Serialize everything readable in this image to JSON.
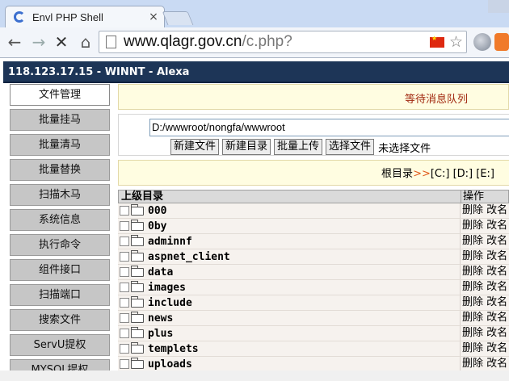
{
  "browser": {
    "tab_title": "Envl PHP Shell",
    "tab_close": "×",
    "url_domain": "www.qlagr.gov.cn",
    "url_path": "/c.php?",
    "nav_back": "←",
    "nav_forward": "→",
    "nav_stop": "✕",
    "nav_home": "⌂",
    "star": "☆"
  },
  "header": {
    "title": "118.123.17.15 - WINNT - Alexa"
  },
  "sidebar": {
    "items": [
      {
        "label": "文件管理",
        "active": true
      },
      {
        "label": "批量挂马"
      },
      {
        "label": "批量清马"
      },
      {
        "label": "批量替换"
      },
      {
        "label": "扫描木马"
      },
      {
        "label": "系统信息"
      },
      {
        "label": "执行命令"
      },
      {
        "label": "组件接口"
      },
      {
        "label": "扫描端口"
      },
      {
        "label": "搜索文件"
      },
      {
        "label": "ServU提权"
      },
      {
        "label": "MYSQL提权"
      }
    ]
  },
  "notice": {
    "message": "等待消息队列"
  },
  "path_bar": {
    "path": "D:/wwwroot/nongfa/wwwroot",
    "new_file": "新建文件",
    "new_dir": "新建目录",
    "batch_upload": "批量上传",
    "choose_file": "选择文件",
    "no_file": "未选择文件"
  },
  "drives": {
    "root_label": "根目录",
    "arrows": ">>",
    "list": "[C:] [D:] [E:]"
  },
  "listing": {
    "col_parent": "上级目录",
    "col_ops": "操作",
    "rows": [
      {
        "name": "000",
        "ops": "删除 改名"
      },
      {
        "name": "0by",
        "ops": "删除 改名"
      },
      {
        "name": "adminnf",
        "ops": "删除 改名"
      },
      {
        "name": "aspnet_client",
        "ops": "删除 改名"
      },
      {
        "name": "data",
        "ops": "删除 改名"
      },
      {
        "name": "images",
        "ops": "删除 改名"
      },
      {
        "name": "include",
        "ops": "删除 改名"
      },
      {
        "name": "news",
        "ops": "删除 改名"
      },
      {
        "name": "plus",
        "ops": "删除 改名"
      },
      {
        "name": "templets",
        "ops": "删除 改名"
      },
      {
        "name": "uploads",
        "ops": "删除 改名"
      }
    ]
  },
  "colors": {
    "header_bg": "#1d3557",
    "notice_bg": "#fffde1",
    "notice_text": "#a1280f",
    "sidebar_btn": "#c6c6c6"
  }
}
